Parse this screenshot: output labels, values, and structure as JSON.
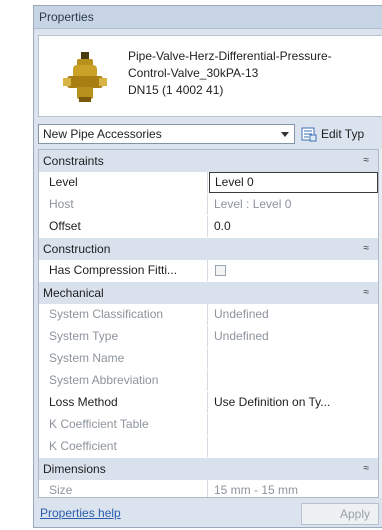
{
  "panel": {
    "title": "Properties"
  },
  "type_selector": {
    "name_lines": [
      "Pipe-Valve-Herz-Differential-Pressure-",
      "Control-Valve_30kPA-13",
      "DN15 (1 4002 41)"
    ],
    "icon": "valve-thumbnail-icon"
  },
  "instance_dropdown": {
    "value": "New Pipe Accessories"
  },
  "edit_type": {
    "label": "Edit Typ",
    "icon": "edit-type-icon"
  },
  "groups": {
    "constraints": {
      "label": "Constraints",
      "rows": {
        "level": {
          "name": "Level",
          "value": "Level 0"
        },
        "host": {
          "name": "Host",
          "value": "Level : Level 0"
        },
        "offset": {
          "name": "Offset",
          "value": "0.0"
        }
      }
    },
    "construction": {
      "label": "Construction",
      "rows": {
        "compression": {
          "name": "Has Compression Fitti..."
        }
      }
    },
    "mechanical": {
      "label": "Mechanical",
      "rows": {
        "system_classification": {
          "name": "System Classification",
          "value": "Undefined"
        },
        "system_type": {
          "name": "System Type",
          "value": "Undefined"
        },
        "system_name": {
          "name": "System Name",
          "value": ""
        },
        "system_abbreviation": {
          "name": "System Abbreviation",
          "value": ""
        },
        "loss_method": {
          "name": "Loss Method",
          "value": "Use Definition on Ty..."
        },
        "k_table": {
          "name": "K Coefficient Table",
          "value": ""
        },
        "k_coefficient": {
          "name": "K Coefficient",
          "value": ""
        }
      }
    },
    "dimensions": {
      "label": "Dimensions",
      "rows": {
        "size": {
          "name": "Size",
          "value": "15 mm - 15 mm"
        }
      }
    }
  },
  "collapse_glyph": "≈",
  "footer": {
    "help_link": "Properties help",
    "apply": "Apply"
  }
}
